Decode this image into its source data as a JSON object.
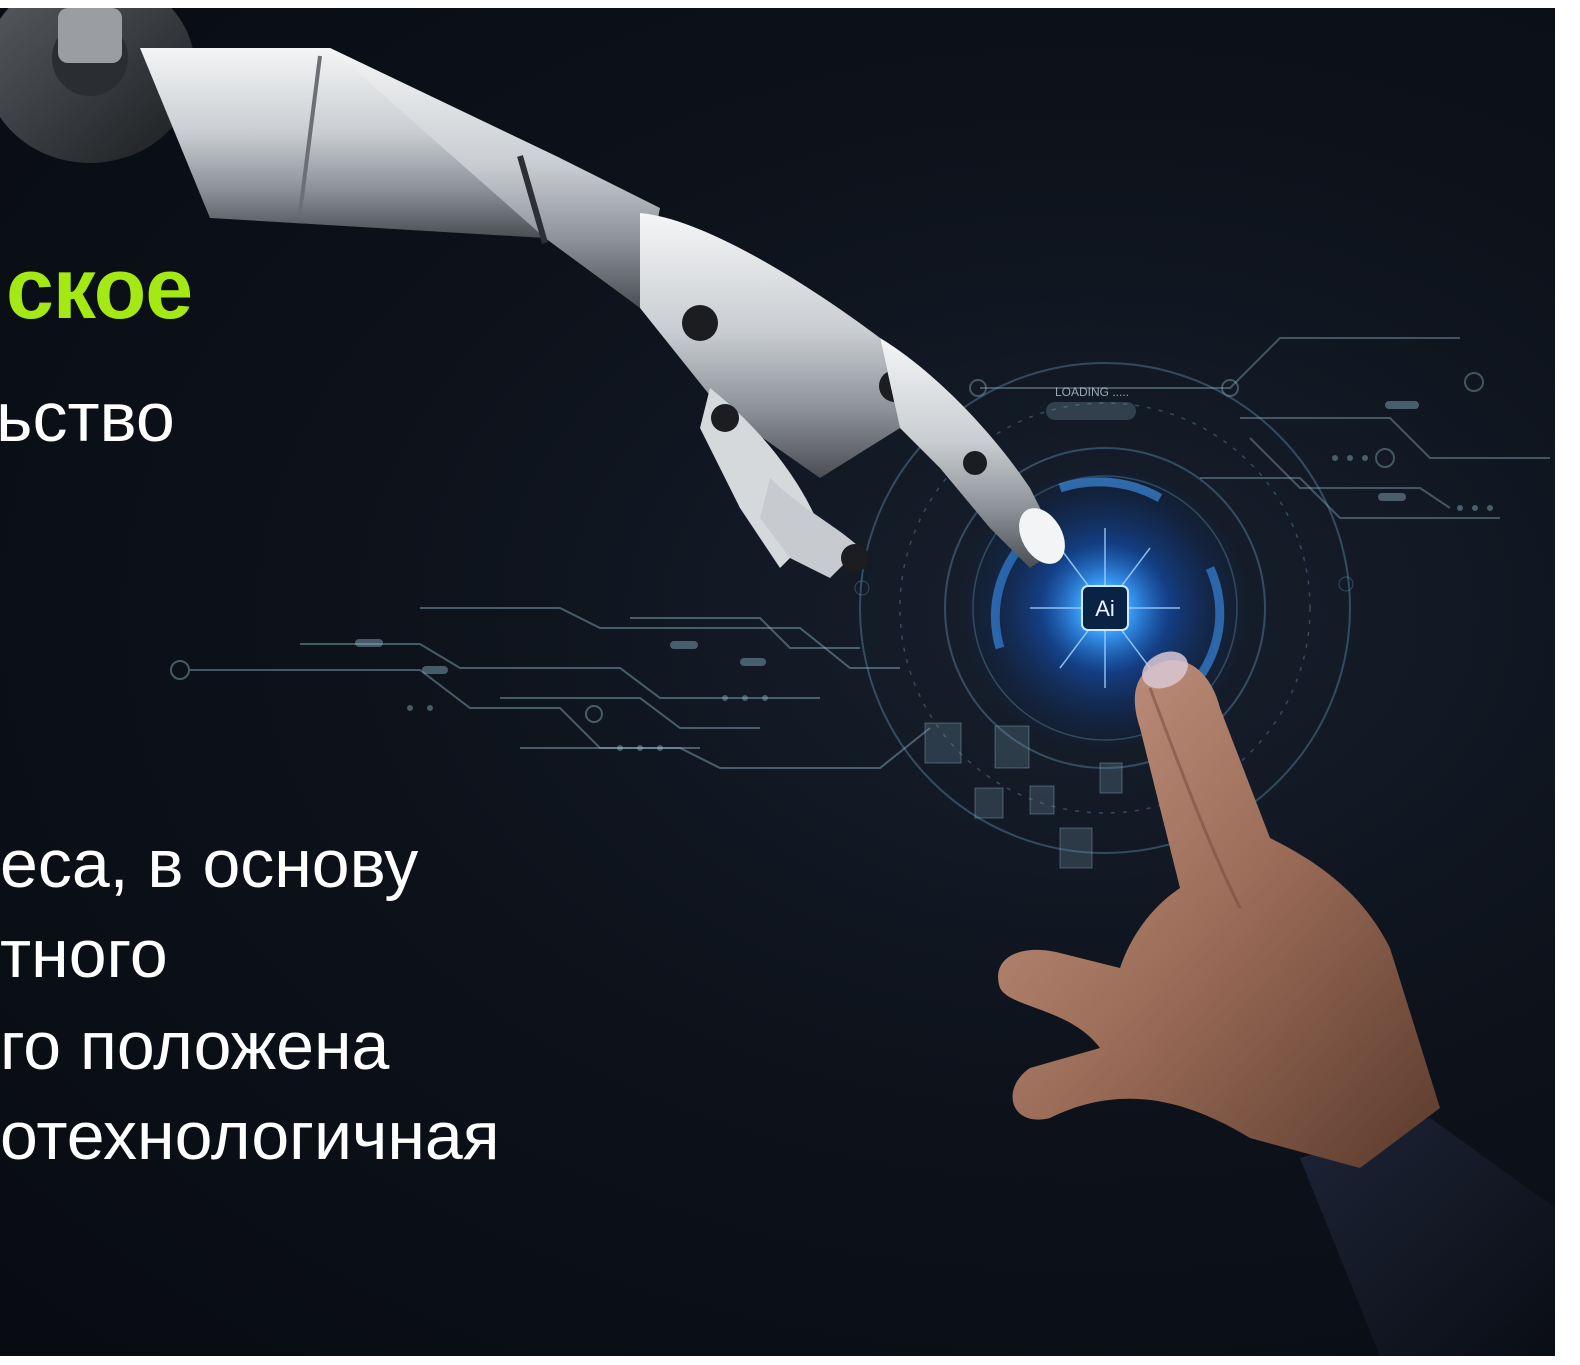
{
  "slide": {
    "headline_accent": "ское",
    "headline_rest": "ьство",
    "body_lines": [
      "еса, в основу",
      "тного",
      "го положена",
      "отехнологичная"
    ]
  },
  "illustration": {
    "chip_label": "Ai",
    "loading_label": "LOADING .....",
    "colors": {
      "background": "#0b1018",
      "accent_green": "#a5e914",
      "glow_blue": "#2f8dff",
      "circuit": "#8fb3c6"
    }
  }
}
